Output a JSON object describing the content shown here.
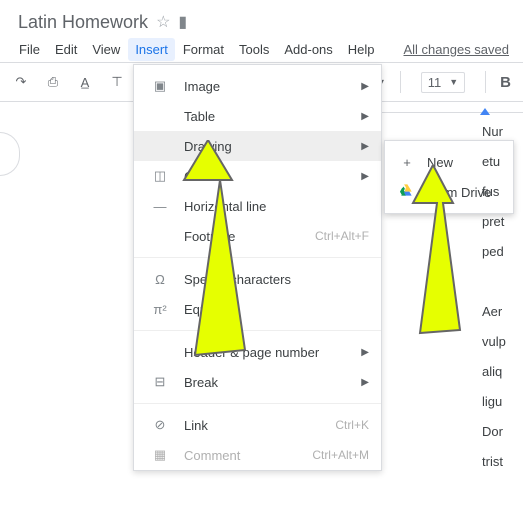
{
  "doc_title": "Latin Homework",
  "menu": {
    "file": "File",
    "edit": "Edit",
    "view": "View",
    "insert": "Insert",
    "format": "Format",
    "tools": "Tools",
    "addons": "Add-ons",
    "help": "Help"
  },
  "changes_saved": "All changes saved",
  "font_size": "11",
  "bold": "B",
  "insert_menu": {
    "image": "Image",
    "table": "Table",
    "drawing": "Drawing",
    "chart": "Chart",
    "hline": "Horizontal line",
    "footnote": "Footnote",
    "footnote_sc": "Ctrl+Alt+F",
    "special": "Special characters",
    "equation": "Equation",
    "header": "Header & page number",
    "break": "Break",
    "link": "Link",
    "link_sc": "Ctrl+K",
    "comment": "Comment",
    "comment_sc": "Ctrl+Alt+M"
  },
  "drawing_menu": {
    "new": "New",
    "drive": "From Drive"
  },
  "doc_words": [
    "Nur",
    "etu",
    "fus",
    "pret",
    "ped",
    "",
    "Aer",
    "vulp",
    "aliq",
    "ligu",
    "Dor",
    "trist"
  ]
}
